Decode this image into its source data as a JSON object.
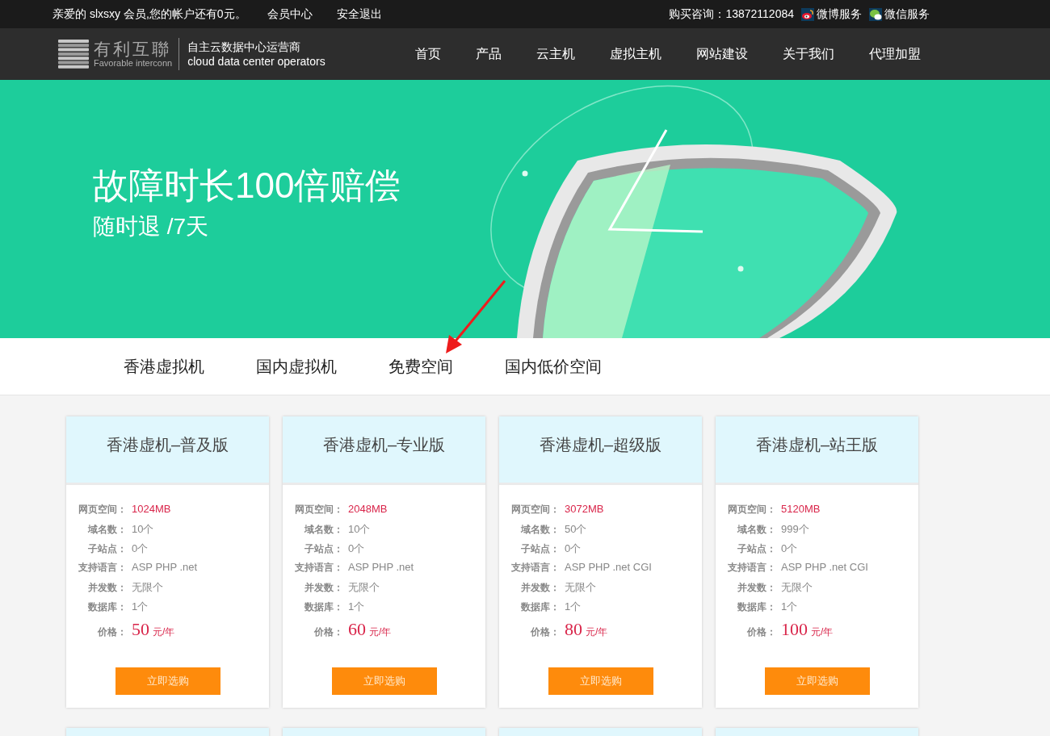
{
  "topbar": {
    "greeting": "亲爱的 slxsxy 会员,您的帐户还有0元。",
    "links": [
      "会员中心",
      "安全退出"
    ],
    "consult": "购买咨询：13872112084",
    "social": [
      {
        "kind": "weibo",
        "label": "微博服务"
      },
      {
        "kind": "wechat",
        "label": "微信服务"
      }
    ]
  },
  "logo": {
    "name": "有利互聯",
    "caption": "Favorable interconn",
    "tagline": "自主云数据中心运营商",
    "tagline_en": "cloud data center operators"
  },
  "nav": [
    "首页",
    "产品",
    "云主机",
    "虚拟主机",
    "网站建设",
    "关于我们",
    "代理加盟"
  ],
  "banner": {
    "title": "故障时长100倍赔偿",
    "subtitle": "随时退 /7天"
  },
  "tabs": [
    "香港虚拟机",
    "国内虚拟机",
    "免费空间",
    "国内低价空间"
  ],
  "plans": [
    {
      "title": "香港虚机–普及版",
      "specs": [
        {
          "label": "网页空间：",
          "value": "1024MB",
          "highlight": true
        },
        {
          "label": "域名数：",
          "value": "10个",
          "highlight": false
        },
        {
          "label": "子站点：",
          "value": "0个",
          "highlight": false
        },
        {
          "label": "支持语言：",
          "value": "ASP PHP .net",
          "highlight": false
        },
        {
          "label": "并发数：",
          "value": "无限个",
          "highlight": false
        },
        {
          "label": "数据库：",
          "value": "1个",
          "highlight": false
        }
      ],
      "price_label": "价格：",
      "price": "50",
      "unit": "元/年",
      "button": "立即选购"
    },
    {
      "title": "香港虚机–专业版",
      "specs": [
        {
          "label": "网页空间：",
          "value": "2048MB",
          "highlight": true
        },
        {
          "label": "域名数：",
          "value": "10个",
          "highlight": false
        },
        {
          "label": "子站点：",
          "value": "0个",
          "highlight": false
        },
        {
          "label": "支持语言：",
          "value": "ASP PHP .net",
          "highlight": false
        },
        {
          "label": "并发数：",
          "value": "无限个",
          "highlight": false
        },
        {
          "label": "数据库：",
          "value": "1个",
          "highlight": false
        }
      ],
      "price_label": "价格：",
      "price": "60",
      "unit": "元/年",
      "button": "立即选购"
    },
    {
      "title": "香港虚机–超级版",
      "specs": [
        {
          "label": "网页空间：",
          "value": "3072MB",
          "highlight": true
        },
        {
          "label": "域名数：",
          "value": "50个",
          "highlight": false
        },
        {
          "label": "子站点：",
          "value": "0个",
          "highlight": false
        },
        {
          "label": "支持语言：",
          "value": "ASP PHP .net CGI",
          "highlight": false
        },
        {
          "label": "并发数：",
          "value": "无限个",
          "highlight": false
        },
        {
          "label": "数据库：",
          "value": "1个",
          "highlight": false
        }
      ],
      "price_label": "价格：",
      "price": "80",
      "unit": "元/年",
      "button": "立即选购"
    },
    {
      "title": "香港虚机–站王版",
      "specs": [
        {
          "label": "网页空间：",
          "value": "5120MB",
          "highlight": true
        },
        {
          "label": "域名数：",
          "value": "999个",
          "highlight": false
        },
        {
          "label": "子站点：",
          "value": "0个",
          "highlight": false
        },
        {
          "label": "支持语言：",
          "value": "ASP PHP .net CGI",
          "highlight": false
        },
        {
          "label": "并发数：",
          "value": "无限个",
          "highlight": false
        },
        {
          "label": "数据库：",
          "value": "1个",
          "highlight": false
        }
      ],
      "price_label": "价格：",
      "price": "100",
      "unit": "元/年",
      "button": "立即选购"
    }
  ]
}
